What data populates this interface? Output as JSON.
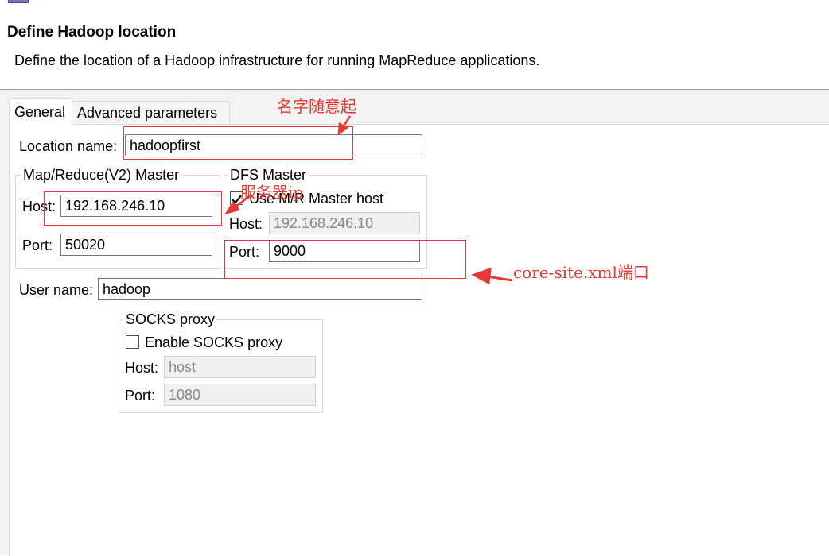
{
  "header": {
    "title": "Define Hadoop location",
    "description": "Define the location of a Hadoop infrastructure for running MapReduce applications."
  },
  "tabs": {
    "general": "General",
    "advanced": "Advanced parameters"
  },
  "general": {
    "location_name_label": "Location name:",
    "location_name_value": "hadoopfirst",
    "mr_master": {
      "title": "Map/Reduce(V2) Master",
      "host_label": "Host:",
      "host_value": "192.168.246.10",
      "port_label": "Port:",
      "port_value": "50020"
    },
    "dfs_master": {
      "title": "DFS Master",
      "use_mr_host_label": "Use M/R Master host",
      "use_mr_host_checked": true,
      "host_label": "Host:",
      "host_value": "192.168.246.10",
      "port_label": "Port:",
      "port_value": "9000"
    },
    "user_name_label": "User name:",
    "user_name_value": "hadoop",
    "socks": {
      "title": "SOCKS proxy",
      "enable_label": "Enable SOCKS proxy",
      "enable_checked": false,
      "host_label": "Host:",
      "host_value": "host",
      "port_label": "Port:",
      "port_value": "1080"
    }
  },
  "annotations": {
    "name_note": "名字随意起",
    "ip_note": "服务器ip",
    "port_note": "core-site.xml端口",
    "color": "#e53935"
  }
}
